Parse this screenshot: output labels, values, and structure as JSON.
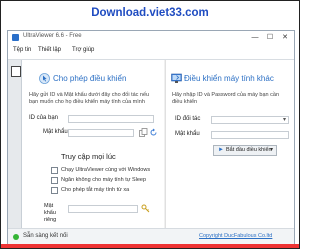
{
  "banner": {
    "text": "Download.viet33.com",
    "color": "#1f4cc1"
  },
  "window": {
    "title": "UltraViewer 6.6 - Free",
    "controls": {
      "minimize": "—",
      "maximize": "☐",
      "close": "✕"
    }
  },
  "menu": [
    "Tệp tin",
    "Thiết lập",
    "Trợ giúp"
  ],
  "left_panel": {
    "header": "Cho phép điều khiển",
    "description": "Hãy gửi ID và Mật khẩu dưới đây cho đối tác nếu bạn muốn cho họ điều khiển máy tính của mình",
    "id_label": "ID của bạn",
    "password_label": "Mật khẩu",
    "section_title": "Truy cập mọi lúc",
    "options": [
      "Chạy UltraViewer cùng với Windows",
      "Ngăn không cho máy tính tự Sleep",
      "Cho phép tắt máy tính từ xa"
    ],
    "options_checked": [
      false,
      false,
      false
    ],
    "password_fixed_label": "Mật khẩu riêng"
  },
  "right_panel": {
    "header": "Điều khiển máy tính khác",
    "description": "Hãy nhập ID và Password của máy bạn cần điều khiển",
    "partner_id_label": "ID đối tác",
    "password_label": "Mật khẩu",
    "partner_id_value": "",
    "password_value": "",
    "connect_button": "Bắt đầu điều khiển"
  },
  "status": {
    "text": "Sẵn sàng kết nối",
    "state_color": "#35b536",
    "copyright": "Copyright DucFabulous Co.ltd"
  }
}
